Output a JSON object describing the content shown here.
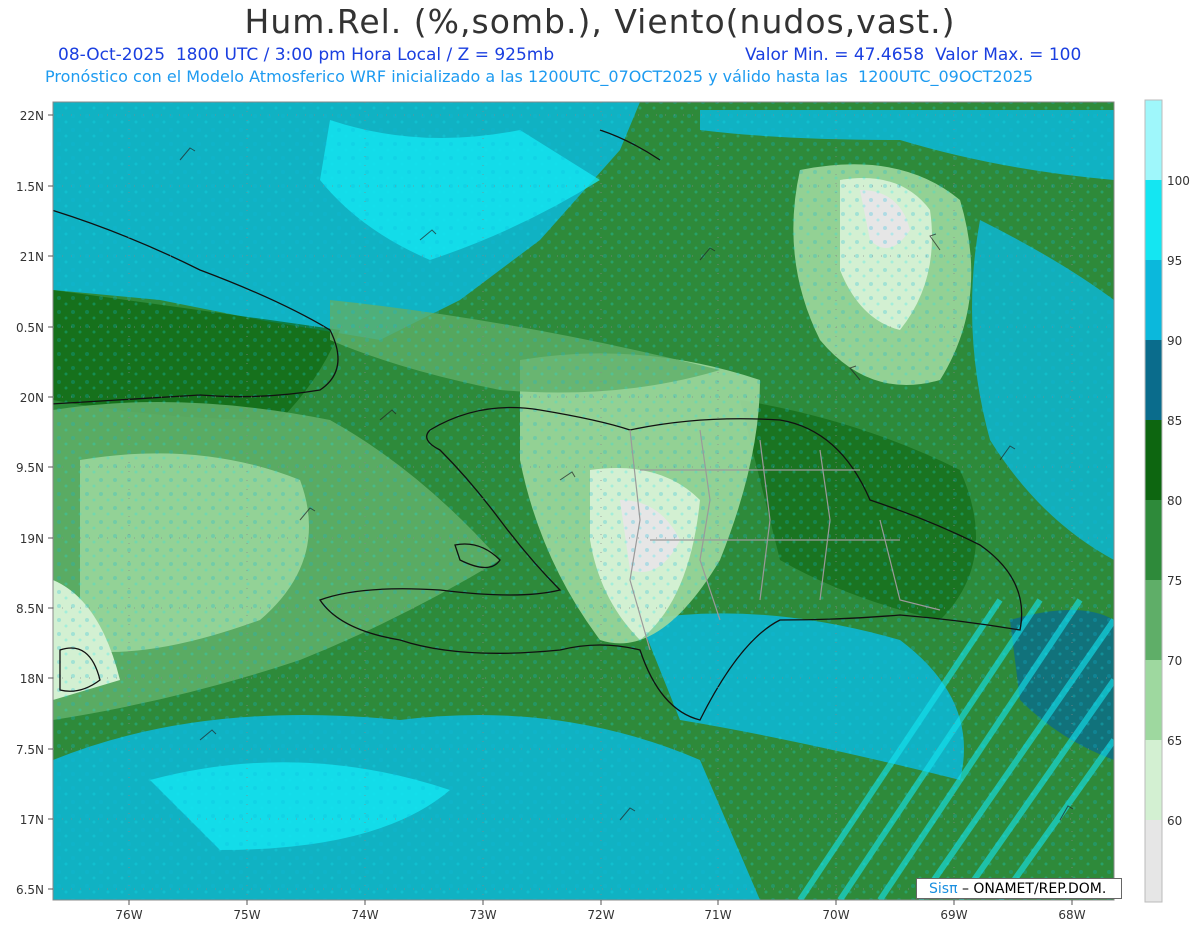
{
  "header": {
    "title": "Hum.Rel. (%,somb.), Viento(nudos,vast.)",
    "date_line": "08-Oct-2025  1800 UTC / 3:00 pm Hora Local / Z = 925mb",
    "minmax_line": "Valor Min. = 47.4658  Valor Max. = 100",
    "model_line": "Pronóstico con el Modelo Atmosferico WRF inicializado a las 1200UTC_07OCT2025 y válido hasta las  1200UTC_09OCT2025"
  },
  "map": {
    "lat_labels": [
      "22N",
      "1.5N",
      "21N",
      "0.5N",
      "20N",
      "9.5N",
      "19N",
      "8.5N",
      "18N",
      "7.5N",
      "17N",
      "6.5N"
    ],
    "lon_labels": [
      "76W",
      "75W",
      "74W",
      "73W",
      "72W",
      "71W",
      "70W",
      "69W",
      "68W"
    ],
    "background_color": "#2f8f3c",
    "coast_color": "#111111",
    "province_color": "#9a9a9a"
  },
  "colorbar": {
    "labels": [
      "100",
      "95",
      "90",
      "85",
      "80",
      "75",
      "70",
      "65",
      "60"
    ],
    "colors": [
      "#9ff7fb",
      "#14e6f2",
      "#0bb8dc",
      "#0a6c8c",
      "#0d6610",
      "#2e8a3a",
      "#5fae68",
      "#9ed89f",
      "#d3f0d2",
      "#e6e6e6"
    ]
  },
  "credit": {
    "logo": "Sisπ",
    "text": "– ONAMET/REP.DOM."
  }
}
